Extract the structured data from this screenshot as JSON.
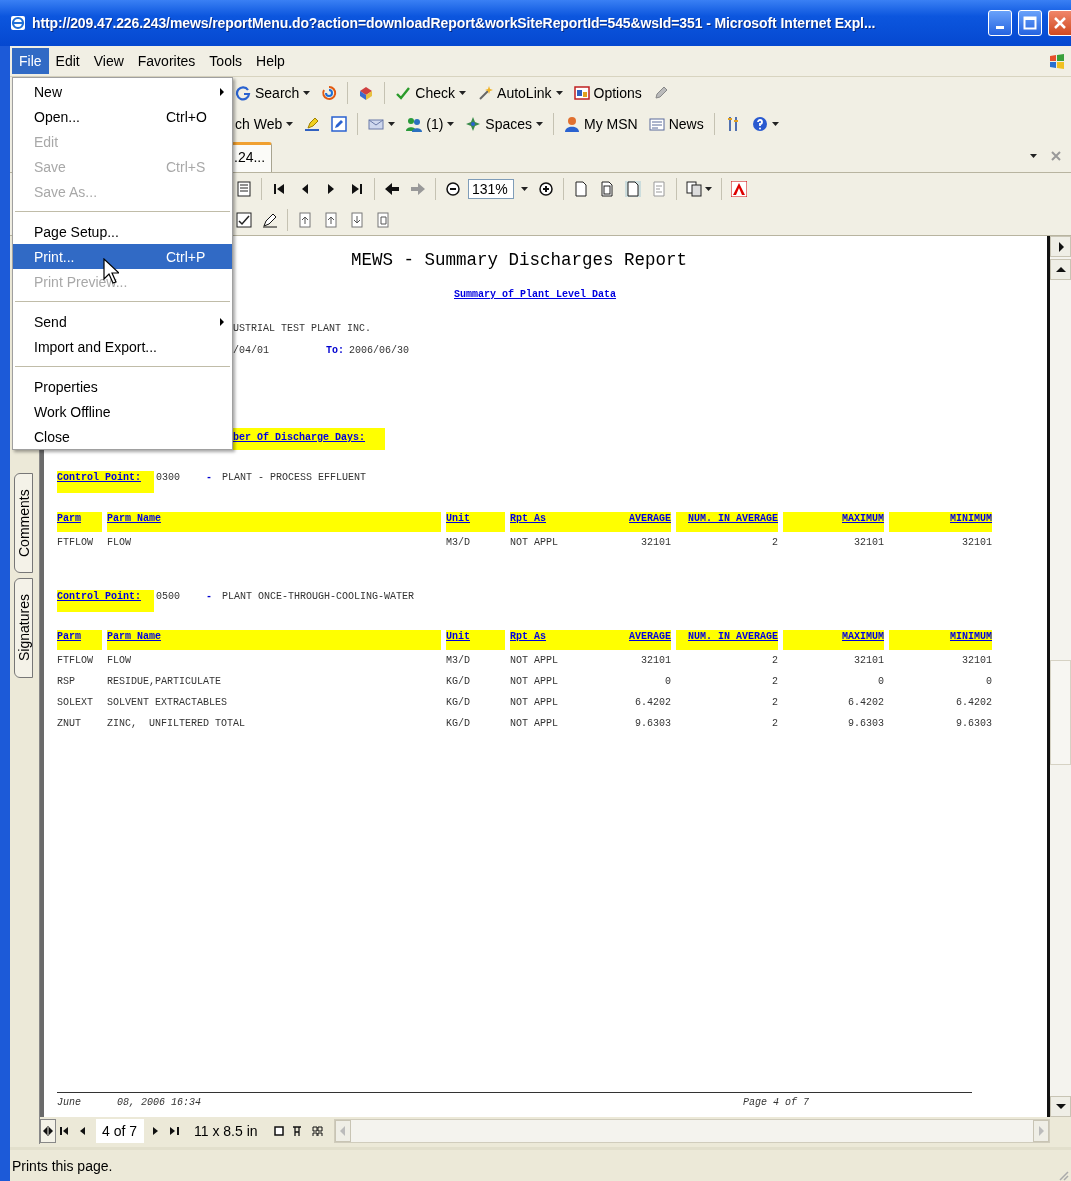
{
  "window": {
    "title": "http://209.47.226.243/mews/reportMenu.do?action=downloadReport&workSiteReportId=545&wsId=351 - Microsoft Internet Expl..."
  },
  "menu_bar": [
    {
      "label": "File",
      "selected": true
    },
    {
      "label": "Edit",
      "selected": false
    },
    {
      "label": "View",
      "selected": false
    },
    {
      "label": "Favorites",
      "selected": false
    },
    {
      "label": "Tools",
      "selected": false
    },
    {
      "label": "Help",
      "selected": false
    }
  ],
  "file_menu": [
    {
      "kind": "item",
      "label": "New",
      "submenu": true,
      "disabled": false,
      "selected": false
    },
    {
      "kind": "item",
      "label": "Open...",
      "shortcut": "Ctrl+O",
      "submenu": false,
      "disabled": false,
      "selected": false
    },
    {
      "kind": "item",
      "label": "Edit",
      "submenu": false,
      "disabled": true,
      "selected": false
    },
    {
      "kind": "item",
      "label": "Save",
      "shortcut": "Ctrl+S",
      "submenu": false,
      "disabled": true,
      "selected": false
    },
    {
      "kind": "item",
      "label": "Save As...",
      "submenu": false,
      "disabled": true,
      "selected": false
    },
    {
      "kind": "separator"
    },
    {
      "kind": "item",
      "label": "Page Setup...",
      "submenu": false,
      "disabled": false,
      "selected": false
    },
    {
      "kind": "item",
      "label": "Print...",
      "shortcut": "Ctrl+P",
      "submenu": false,
      "disabled": false,
      "selected": true
    },
    {
      "kind": "item",
      "label": "Print Preview...",
      "submenu": false,
      "disabled": true,
      "selected": false
    },
    {
      "kind": "separator"
    },
    {
      "kind": "item",
      "label": "Send",
      "submenu": true,
      "disabled": false,
      "selected": false
    },
    {
      "kind": "item",
      "label": "Import and Export...",
      "submenu": false,
      "disabled": false,
      "selected": false
    },
    {
      "kind": "separator"
    },
    {
      "kind": "item",
      "label": "Properties",
      "submenu": false,
      "disabled": false,
      "selected": false
    },
    {
      "kind": "item",
      "label": "Work Offline",
      "submenu": false,
      "disabled": false,
      "selected": false
    },
    {
      "kind": "item",
      "label": "Close",
      "submenu": false,
      "disabled": false,
      "selected": false
    }
  ],
  "toolbar_1": [
    {
      "kind": "button",
      "label": "Search",
      "dropdown": true
    },
    {
      "kind": "icon",
      "dropdown": false
    },
    {
      "kind": "separator"
    },
    {
      "kind": "icon",
      "dropdown": false
    },
    {
      "kind": "separator"
    },
    {
      "kind": "button",
      "label": "Check",
      "dropdown": true
    },
    {
      "kind": "button",
      "label": "AutoLink",
      "dropdown": true
    },
    {
      "kind": "button",
      "label": "Options",
      "dropdown": false
    },
    {
      "kind": "icon",
      "dropdown": false
    }
  ],
  "toolbar_2": [
    {
      "kind": "text",
      "label": "ch Web",
      "dropdown": true
    },
    {
      "kind": "icon",
      "dropdown": false
    },
    {
      "kind": "icon",
      "dropdown": false
    },
    {
      "kind": "separator"
    },
    {
      "kind": "icon",
      "dropdown": true
    },
    {
      "kind": "button",
      "label": "(1)",
      "dropdown": true
    },
    {
      "kind": "button",
      "label": "Spaces",
      "dropdown": true
    },
    {
      "kind": "separator"
    },
    {
      "kind": "button",
      "label": "My MSN",
      "dropdown": false
    },
    {
      "kind": "button",
      "label": "News",
      "dropdown": false
    },
    {
      "kind": "separator"
    },
    {
      "kind": "icon",
      "dropdown": false
    },
    {
      "kind": "icon",
      "dropdown": true
    }
  ],
  "tabs": [
    {
      "label": ".24...",
      "selected": true
    }
  ],
  "acrobat": {
    "zoom": "131%"
  },
  "side_tabs": [
    {
      "label": "Comments"
    },
    {
      "label": "Signatures"
    }
  ],
  "report": {
    "title": "MEWS - Summary Discharges Report",
    "link": "Summary of Plant Level Data",
    "facility": "USTRIAL TEST PLANT INC.",
    "from_date": "/04/01",
    "to_label": "To:",
    "to_date": "2006/06/30",
    "discharge_days_label": "ber Of Discharge Days:",
    "sections": [
      {
        "label": "Control Point:",
        "code": "0300",
        "separator": "-",
        "name": "PLANT - PROCESS EFFLUENT",
        "columns": [
          "Parm",
          "Parm Name",
          "Unit",
          "Rpt As",
          "AVERAGE",
          "NUM. IN AVERAGE",
          "MAXIMUM",
          "MINIMUM"
        ],
        "rows": [
          [
            "FTFLOW",
            "FLOW",
            "M3/D",
            "NOT APPL",
            "32101",
            "2",
            "32101",
            "32101"
          ]
        ]
      },
      {
        "label": "Control Point:",
        "code": "0500",
        "separator": "-",
        "name": "PLANT ONCE-THROUGH-COOLING-WATER",
        "columns": [
          "Parm",
          "Parm Name",
          "Unit",
          "Rpt As",
          "AVERAGE",
          "NUM. IN AVERAGE",
          "MAXIMUM",
          "MINIMUM"
        ],
        "rows": [
          [
            "FTFLOW",
            "FLOW",
            "M3/D",
            "NOT APPL",
            "32101",
            "2",
            "32101",
            "32101"
          ],
          [
            "RSP",
            "RESIDUE,PARTICULATE",
            "KG/D",
            "NOT APPL",
            "0",
            "2",
            "0",
            "0"
          ],
          [
            "SOLEXT",
            "SOLVENT EXTRACTABLES",
            "KG/D",
            "NOT APPL",
            "6.4202",
            "2",
            "6.4202",
            "6.4202"
          ],
          [
            "ZNUT",
            "ZINC,  UNFILTERED TOTAL",
            "KG/D",
            "NOT APPL",
            "9.6303",
            "2",
            "9.6303",
            "9.6303"
          ]
        ]
      }
    ],
    "footer": {
      "month": "June",
      "date": "08, 2006 16:34",
      "page": "Page 4 of 7"
    }
  },
  "navigation": {
    "page": "4 of 7",
    "page_size": "11 x 8.5 in"
  },
  "status_bar": "Prints this page."
}
